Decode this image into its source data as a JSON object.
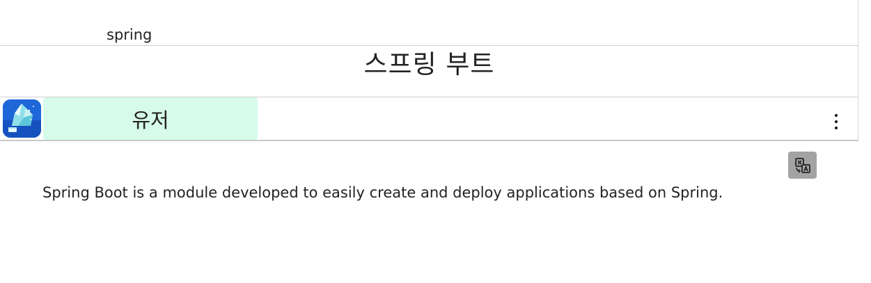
{
  "topic": "spring",
  "title": "스프링 부트",
  "header": {
    "app_icon": "iceberg-icon",
    "tab_label": "유저",
    "menu_icon": "more-vertical-icon"
  },
  "toolbar": {
    "translate_icon": "translate-icon"
  },
  "content": {
    "text": "Spring Boot is a module developed to easily create and deploy applications based on Spring."
  },
  "colors": {
    "tab_bg": "#d6fbea",
    "app_icon_bg": "#1e67d8",
    "translate_btn_bg": "#a3a3a3",
    "divider": "#cfcfcf"
  }
}
